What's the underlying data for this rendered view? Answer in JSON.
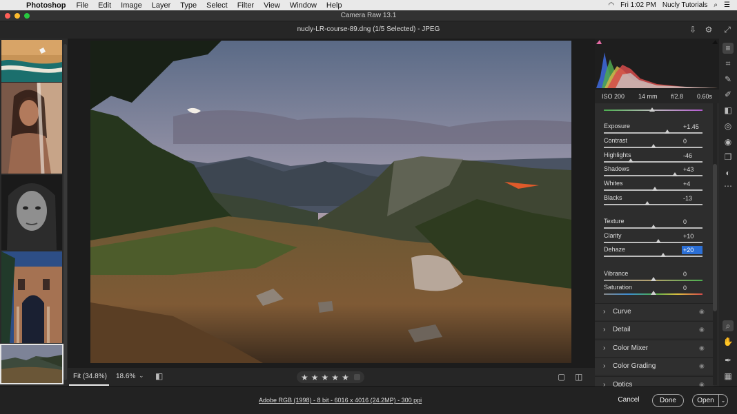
{
  "menubar": {
    "app_name": "Photoshop",
    "items": [
      "File",
      "Edit",
      "Image",
      "Layer",
      "Type",
      "Select",
      "Filter",
      "View",
      "Window",
      "Help"
    ],
    "clock": "Fri 1:02 PM",
    "user": "Nucly Tutorials"
  },
  "window": {
    "title": "Camera Raw 13.1"
  },
  "header": {
    "file": "nucly-LR-course-89.dng (1/5 Selected)  -  JPEG"
  },
  "exif": {
    "iso": "ISO 200",
    "focal": "14 mm",
    "aperture": "f/2.8",
    "shutter": "0.60s"
  },
  "adjustments": [
    {
      "label": "Exposure",
      "value": "+1.45",
      "level": 0.64
    },
    {
      "label": "Contrast",
      "value": "0",
      "level": 0.5
    },
    {
      "label": "Highlights",
      "value": "-46",
      "level": 0.27
    },
    {
      "label": "Shadows",
      "value": "+43",
      "level": 0.72
    },
    {
      "label": "Whites",
      "value": "+4",
      "level": 0.52
    },
    {
      "label": "Blacks",
      "value": "-13",
      "level": 0.44
    },
    {
      "label": "Texture",
      "value": "0",
      "level": 0.5
    },
    {
      "label": "Clarity",
      "value": "+10",
      "level": 0.55
    },
    {
      "label": "Dehaze",
      "value": "+20",
      "level": 0.6
    },
    {
      "label": "Vibrance",
      "value": "0",
      "level": 0.5
    },
    {
      "label": "Saturation",
      "value": "0",
      "level": 0.5
    }
  ],
  "sections": [
    "Curve",
    "Detail",
    "Color Mixer",
    "Color Grading",
    "Optics"
  ],
  "bottom": {
    "fit": "Fit (34.8%)",
    "zoom": "18.6%",
    "stars": [
      "★",
      "★",
      "★",
      "★",
      "★"
    ]
  },
  "footer": {
    "info": "Adobe RGB (1998) - 8 bit - 6016 x 4016 (24.2MP) - 300 ppi",
    "cancel": "Cancel",
    "done": "Done",
    "open": "Open"
  },
  "icons": {
    "apple": "",
    "wifi": "◠",
    "search": "⌕",
    "menu": "☰",
    "gear": "⚙",
    "expand": "⤢",
    "save": "⇩",
    "chevron_right": "›",
    "chevron_down": "⌄",
    "eye": "◉",
    "compare": "◧",
    "single_view": "▢",
    "split_view": "◫"
  }
}
